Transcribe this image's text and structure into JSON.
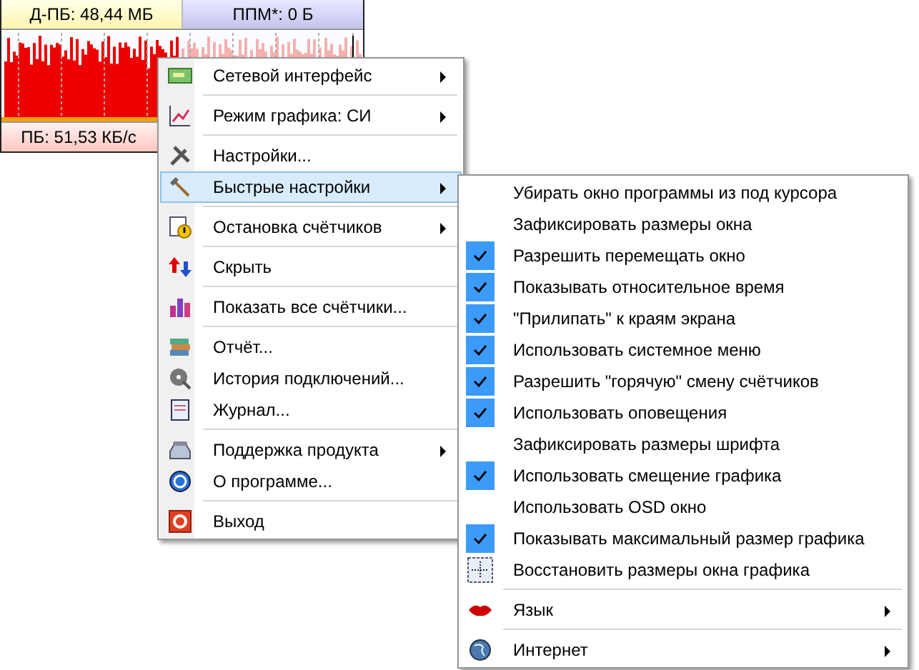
{
  "widget": {
    "download_total": "Д-ПБ: 48,44 МБ",
    "peak": "ППМ*: 0 Б",
    "speed": "ПБ: 51,53 КБ/с"
  },
  "main_menu": {
    "groups": [
      [
        {
          "label": "Сетевой интерфейс",
          "submenu": true,
          "selected": false
        }
      ],
      [
        {
          "label": "Режим графика: СИ",
          "submenu": true,
          "selected": false
        }
      ],
      [
        {
          "label": "Настройки...",
          "submenu": false,
          "selected": false
        },
        {
          "label": "Быстрые настройки",
          "submenu": true,
          "selected": true
        }
      ],
      [
        {
          "label": "Остановка счётчиков",
          "submenu": true,
          "selected": false
        }
      ],
      [
        {
          "label": "Скрыть",
          "submenu": false,
          "selected": false
        }
      ],
      [
        {
          "label": "Показать все счётчики...",
          "submenu": false,
          "selected": false
        }
      ],
      [
        {
          "label": "Отчёт...",
          "submenu": false,
          "selected": false
        },
        {
          "label": "История подключений...",
          "submenu": false,
          "selected": false
        },
        {
          "label": "Журнал...",
          "submenu": false,
          "selected": false
        }
      ],
      [
        {
          "label": "Поддержка продукта",
          "submenu": true,
          "selected": false
        },
        {
          "label": "О программе...",
          "submenu": false,
          "selected": false
        }
      ],
      [
        {
          "label": "Выход",
          "submenu": false,
          "selected": false
        }
      ]
    ]
  },
  "quick_settings_menu": {
    "groups": [
      [
        {
          "kind": "check",
          "label": "Убирать окно программы из под курсора",
          "checked": false
        },
        {
          "kind": "check",
          "label": "Зафиксировать размеры окна",
          "checked": false
        },
        {
          "kind": "check",
          "label": "Разрешить перемещать окно",
          "checked": true
        },
        {
          "kind": "check",
          "label": "Показывать относительное время",
          "checked": true
        },
        {
          "kind": "check",
          "label": "\"Прилипать\" к краям экрана",
          "checked": true
        },
        {
          "kind": "check",
          "label": "Использовать системное меню",
          "checked": true
        },
        {
          "kind": "check",
          "label": "Разрешить \"горячую\" смену счётчиков",
          "checked": true
        },
        {
          "kind": "check",
          "label": "Использовать оповещения",
          "checked": true
        },
        {
          "kind": "check",
          "label": "Зафиксировать размеры шрифта",
          "checked": false
        },
        {
          "kind": "check",
          "label": "Использовать смещение графика",
          "checked": true
        },
        {
          "kind": "check",
          "label": "Использовать OSD окно",
          "checked": false
        },
        {
          "kind": "check",
          "label": "Показывать максимальный размер графика",
          "checked": true
        },
        {
          "kind": "command",
          "label": "Восстановить размеры окна графика"
        }
      ],
      [
        {
          "kind": "submenu",
          "label": "Язык"
        }
      ],
      [
        {
          "kind": "submenu",
          "label": "Интернет"
        }
      ]
    ]
  }
}
